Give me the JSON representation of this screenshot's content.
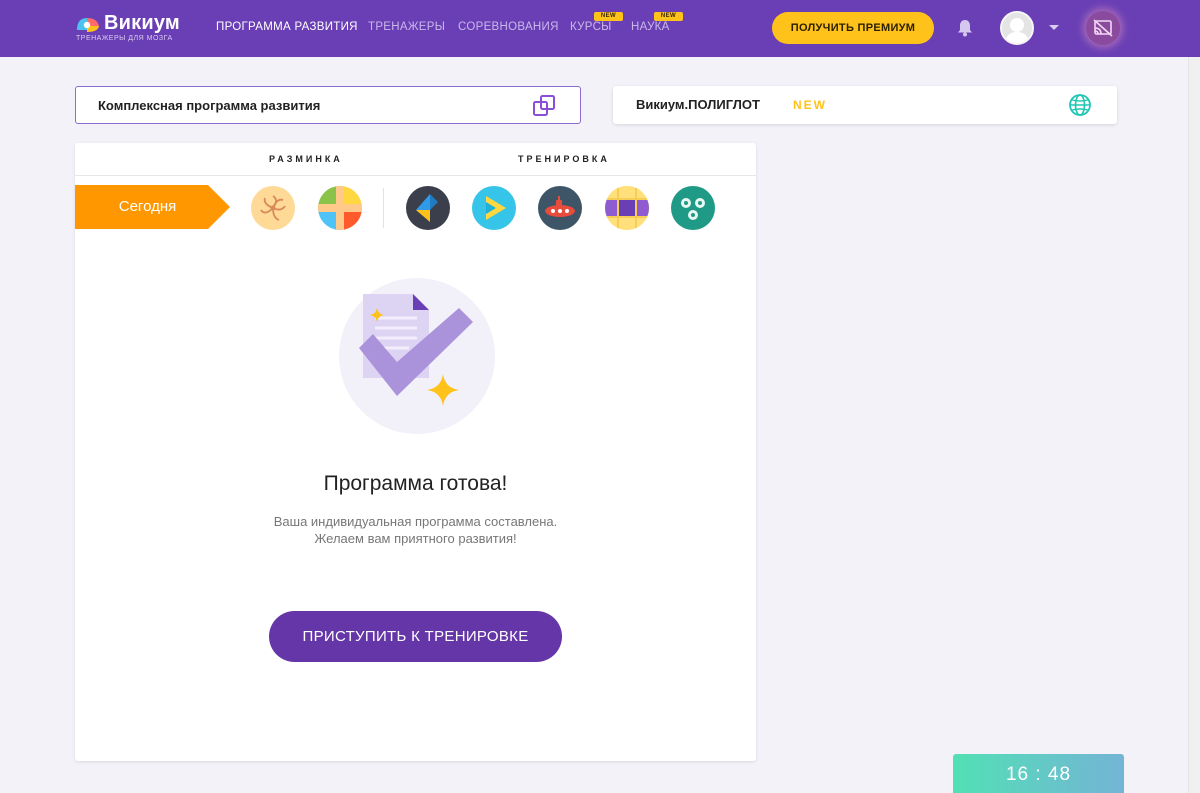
{
  "header": {
    "logo": {
      "name": "Викиум",
      "tagline": "ТРЕНАЖЕРЫ ДЛЯ МОЗГА"
    },
    "nav": [
      {
        "label": "ПРОГРАММА РАЗВИТИЯ",
        "active": true,
        "badge": ""
      },
      {
        "label": "ТРЕНАЖЕРЫ",
        "active": false,
        "badge": ""
      },
      {
        "label": "СОРЕВНОВАНИЯ",
        "active": false,
        "badge": ""
      },
      {
        "label": "КУРСЫ",
        "active": false,
        "badge": "NEW"
      },
      {
        "label": "НАУКА",
        "active": false,
        "badge": "NEW"
      }
    ],
    "premium_label": "ПОЛУЧИТЬ ПРЕМИУМ",
    "bell_icon": "bell-icon",
    "avatar_icon": "user-avatar",
    "cast_icon": "cast-icon"
  },
  "cards": {
    "program": {
      "label": "Комплексная программа развития",
      "icon": "switch-program-icon"
    },
    "polyglot": {
      "label": "Викиум.ПОЛИГЛОТ",
      "badge": "NEW",
      "icon": "globe-icon"
    }
  },
  "panel": {
    "warmup_label": "РАЗМИНКА",
    "training_label": "ТРЕНИРОВКА",
    "today_label": "Сегодня",
    "warmup_games": [
      "spiral-game-icon",
      "color-grid-game-icon"
    ],
    "training_games": [
      "arrows-game-icon",
      "play-game-icon",
      "submarine-game-icon",
      "tiles-game-icon",
      "balls-game-icon"
    ],
    "title": "Программа готова!",
    "subtitle_1": "Ваша индивидуальная программа составлена.",
    "subtitle_2": "Желаем вам приятного развития!",
    "start_label": "ПРИСТУПИТЬ К ТРЕНИРОВКЕ"
  },
  "timer": "16 : 48",
  "colors": {
    "header_bg": "#6a3fb5",
    "premium_yellow": "#ffc21a",
    "today_orange": "#ff9800",
    "start_button": "#6436a8",
    "timer_gradient_start": "#52e0b4",
    "timer_gradient_end": "#74b4d6"
  }
}
